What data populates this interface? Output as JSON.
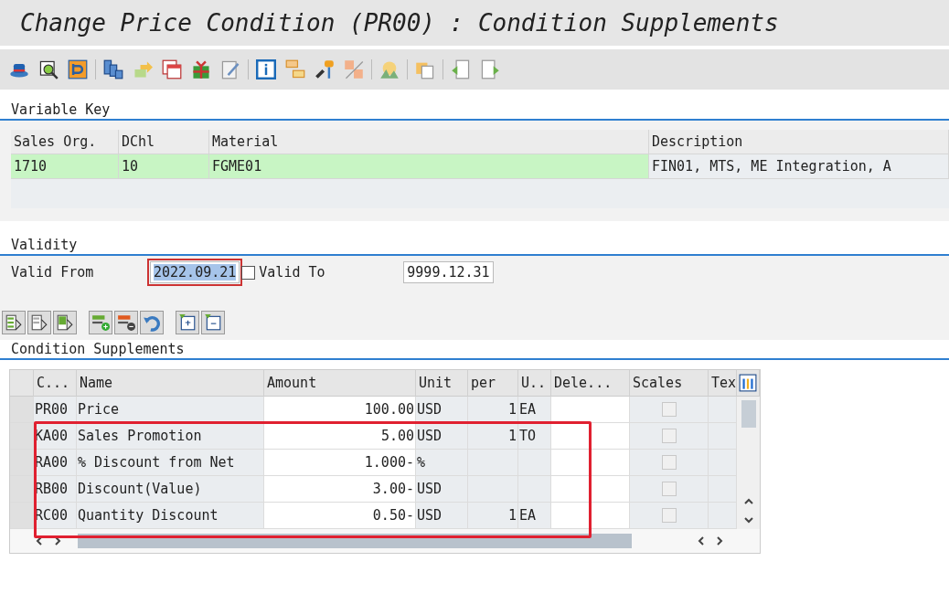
{
  "window": {
    "title": "Change Price Condition (PR00) : Condition Supplements"
  },
  "variable_key": {
    "heading": "Variable Key",
    "columns": [
      "Sales Org.",
      "DChl",
      "Material",
      "Description"
    ],
    "rows": [
      {
        "cells": [
          "1710",
          "10",
          "FGME01",
          "FIN01, MTS, ME Integration, A"
        ]
      }
    ]
  },
  "validity": {
    "heading": "Validity",
    "valid_from_label": "Valid From",
    "valid_from": "2022.09.21",
    "valid_to_label": "Valid To",
    "valid_to": "9999.12.31"
  },
  "supplements": {
    "heading": "Condition Supplements",
    "columns": [
      "C...",
      "Name",
      "Amount",
      "Unit",
      "per",
      "U..",
      "Dele...",
      "Scales",
      "Tex"
    ],
    "rows": [
      {
        "cells": [
          "PR00",
          "Price",
          "100.00",
          "USD",
          "1",
          "EA",
          ""
        ],
        "scales_checked": false,
        "highlighted": false
      },
      {
        "cells": [
          "KA00",
          "Sales Promotion",
          "5.00",
          "USD",
          "1",
          "TO",
          ""
        ],
        "scales_checked": false,
        "highlighted": true
      },
      {
        "cells": [
          "RA00",
          "% Discount from Net",
          "1.000-",
          "%",
          "",
          "",
          ""
        ],
        "scales_checked": false,
        "highlighted": true
      },
      {
        "cells": [
          "RB00",
          "Discount(Value)",
          "3.00-",
          "USD",
          "",
          "",
          ""
        ],
        "scales_checked": false,
        "highlighted": true
      },
      {
        "cells": [
          "RC00",
          "Quantity Discount",
          "0.50-",
          "USD",
          "1",
          "EA",
          ""
        ],
        "scales_checked": false,
        "highlighted": true
      }
    ]
  }
}
